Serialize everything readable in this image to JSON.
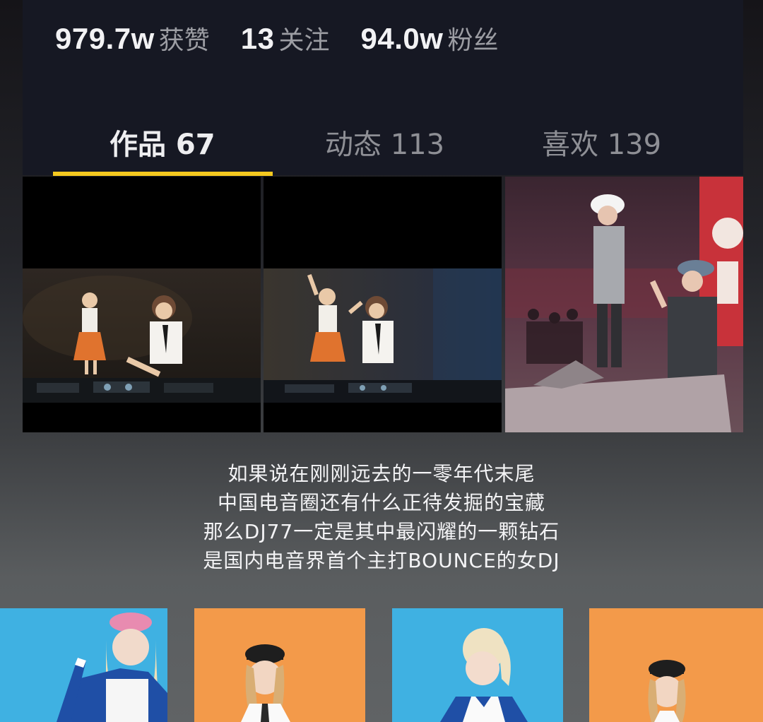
{
  "profile": {
    "stats": [
      {
        "value": "979.7w",
        "label": "获赞"
      },
      {
        "value": "13",
        "label": "关注"
      },
      {
        "value": "94.0w",
        "label": "粉丝"
      }
    ],
    "tabs": [
      {
        "label": "作品 67",
        "active": true
      },
      {
        "label": "动态 113",
        "active": false
      },
      {
        "label": "喜欢 139",
        "active": false
      }
    ],
    "accent_color": "#f5c91f"
  },
  "caption": {
    "lines": [
      "如果说在刚刚远去的一零年代末尾",
      "中国电音圈还有什么正待发掘的宝藏",
      "那么DJ77一定是其中最闪耀的一颗钻石",
      "是国内电音界首个主打BOUNCE的女DJ"
    ]
  }
}
